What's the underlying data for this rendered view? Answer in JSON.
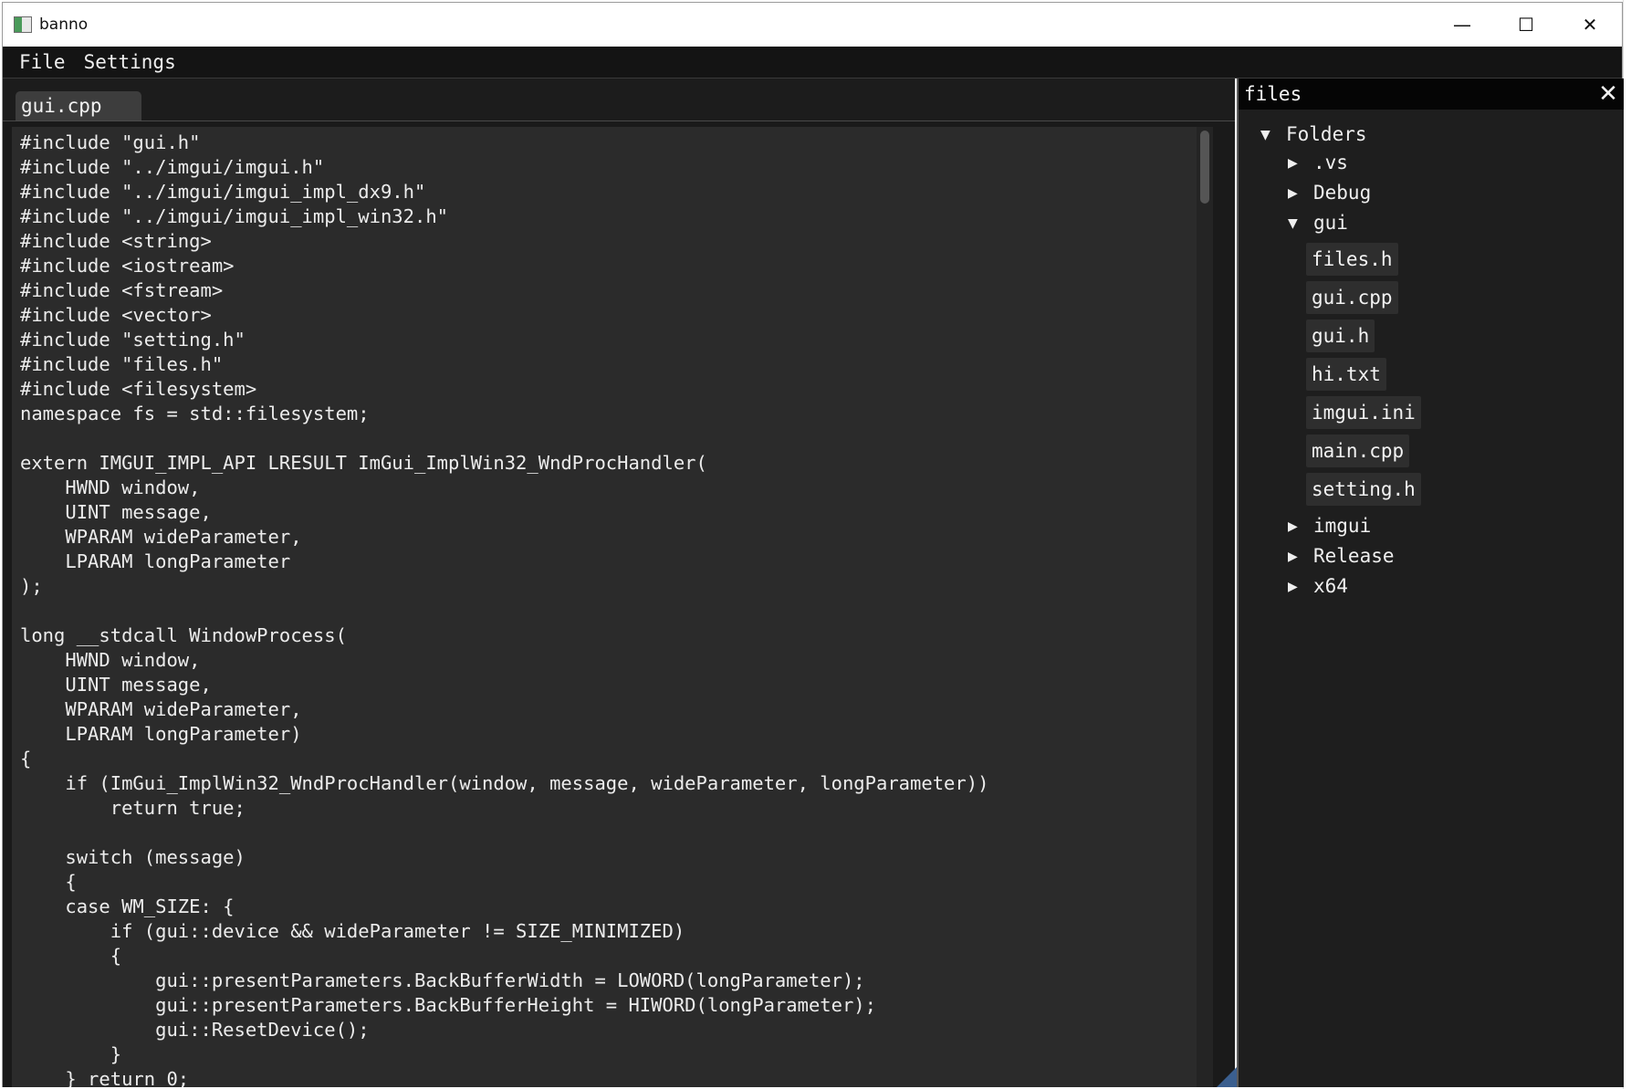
{
  "window": {
    "title": "banno",
    "controls": {
      "minimize": "—",
      "maximize": "☐",
      "close": "✕"
    }
  },
  "menu": {
    "file": "File",
    "settings": "Settings"
  },
  "editor": {
    "tab_label": "gui.cpp",
    "code_lines": [
      "#include \"gui.h\"",
      "#include \"../imgui/imgui.h\"",
      "#include \"../imgui/imgui_impl_dx9.h\"",
      "#include \"../imgui/imgui_impl_win32.h\"",
      "#include <string>",
      "#include <iostream>",
      "#include <fstream>",
      "#include <vector>",
      "#include \"setting.h\"",
      "#include \"files.h\"",
      "#include <filesystem>",
      "namespace fs = std::filesystem;",
      "",
      "extern IMGUI_IMPL_API LRESULT ImGui_ImplWin32_WndProcHandler(",
      "    HWND window,",
      "    UINT message,",
      "    WPARAM wideParameter,",
      "    LPARAM longParameter",
      ");",
      "",
      "long __stdcall WindowProcess(",
      "    HWND window,",
      "    UINT message,",
      "    WPARAM wideParameter,",
      "    LPARAM longParameter)",
      "{",
      "    if (ImGui_ImplWin32_WndProcHandler(window, message, wideParameter, longParameter))",
      "        return true;",
      "",
      "    switch (message)",
      "    {",
      "    case WM_SIZE: {",
      "        if (gui::device && wideParameter != SIZE_MINIMIZED)",
      "        {",
      "            gui::presentParameters.BackBufferWidth = LOWORD(longParameter);",
      "            gui::presentParameters.BackBufferHeight = HIWORD(longParameter);",
      "            gui::ResetDevice();",
      "        }",
      "    } return 0;"
    ]
  },
  "files_panel": {
    "title": "files",
    "close": "✕",
    "tree": {
      "root": "Folders",
      "folders": [
        ".vs",
        "Debug",
        "gui",
        "imgui",
        "Release",
        "x64"
      ],
      "gui_files": [
        "files.h",
        "gui.cpp",
        "gui.h",
        "hi.txt",
        "imgui.ini",
        "main.cpp",
        "setting.h"
      ]
    }
  },
  "icons": {
    "expanded": "▼",
    "collapsed": "▶"
  },
  "colors": {
    "menubar": "#141414",
    "editor_bg": "#2b2b2b",
    "panel_bg": "#1e1e1e",
    "tab": "#3d3d3d"
  }
}
